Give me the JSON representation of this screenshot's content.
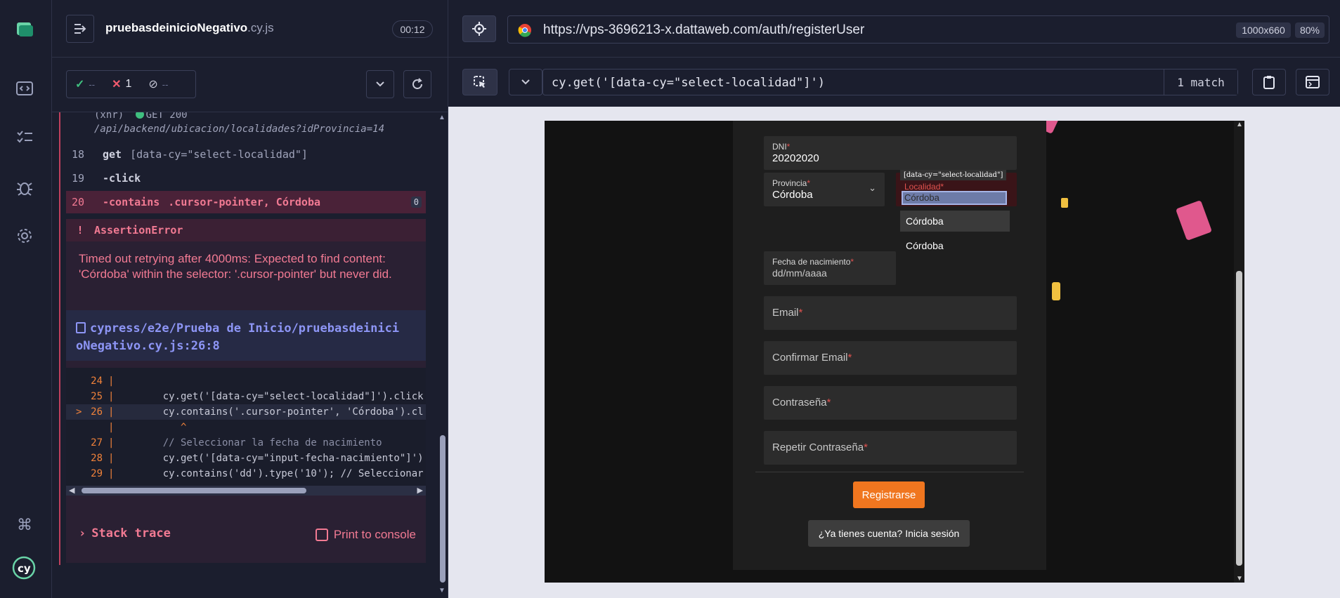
{
  "reporter": {
    "spec_name": "pruebasdeinicioNegativo",
    "spec_ext": ".cy.js",
    "timer": "00:12",
    "stats": {
      "passed": "--",
      "failed": "1",
      "pending": "--"
    }
  },
  "log": {
    "xhr_prefix": "(xhr)",
    "xhr_status": "GET 200",
    "xhr_url": "/api/backend/ubicacion/localidades?idProvincia=14",
    "commands": [
      {
        "num": "18",
        "name": "get",
        "msg": "[data-cy=\"select-localidad\"]",
        "badge": ""
      },
      {
        "num": "19",
        "name": "-click",
        "msg": "",
        "badge": ""
      },
      {
        "num": "20",
        "name": "-contains",
        "msg": ".cursor-pointer, Córdoba",
        "badge": "0"
      }
    ],
    "error": {
      "icon": "!",
      "type": "AssertionError",
      "message": "Timed out retrying after 4000ms: Expected to find content: 'Córdoba' within the selector: '.cursor-pointer' but never did.",
      "file_line1": "cypress/e2e/Prueba de Inicio/pruebasdeinici",
      "file_line2": "oNegativo.cy.js:26:8",
      "code": [
        {
          "ln": "24",
          "marker": "",
          "text": ""
        },
        {
          "ln": "25",
          "marker": "",
          "text": "    cy.get('[data-cy=\"select-localidad\"]').click"
        },
        {
          "ln": "26",
          "marker": ">",
          "text": "    cy.contains('.cursor-pointer', 'Córdoba').cl"
        },
        {
          "ln": "",
          "marker": "",
          "text": "       ^"
        },
        {
          "ln": "27",
          "marker": "",
          "text": "    // Seleccionar la fecha de nacimiento"
        },
        {
          "ln": "28",
          "marker": "",
          "text": "    cy.get('[data-cy=\"input-fecha-nacimiento\"]')"
        },
        {
          "ln": "29",
          "marker": "",
          "text": "    cy.contains('dd').type('10'); // Seleccionar"
        }
      ],
      "stack_trace": "Stack trace",
      "print_console": "Print to console"
    }
  },
  "browser": {
    "url": "https://vps-3696213-x.dattaweb.com/auth/registerUser",
    "viewport": "1000x660",
    "zoom": "80%",
    "selector": "cy.get('[data-cy=\"select-localidad\"]')",
    "match": "1 match"
  },
  "form": {
    "dni_label": "DNI",
    "dni_value": "20202020",
    "provincia_label": "Provincia",
    "provincia_value": "Córdoba",
    "localidad_label": "Localidad",
    "localidad_value": "Córdoba",
    "tooltip": "[data-cy=\"select-localidad\"]",
    "options": [
      "Córdoba",
      "Córdoba"
    ],
    "fecha_label": "Fecha de nacimiento",
    "fecha_placeholder": "dd/mm/aaaa",
    "email_label": "Email",
    "confirm_email_label": "Confirmar Email",
    "password_label": "Contraseña",
    "repeat_password_label": "Repetir Contraseña",
    "required_mark": "*",
    "register_button": "Registrarse",
    "login_button": "¿Ya tienes cuenta? Inicia sesión"
  },
  "colors": {
    "accent": "#f0761f",
    "error": "#f27a93",
    "link": "#8d95f5"
  }
}
